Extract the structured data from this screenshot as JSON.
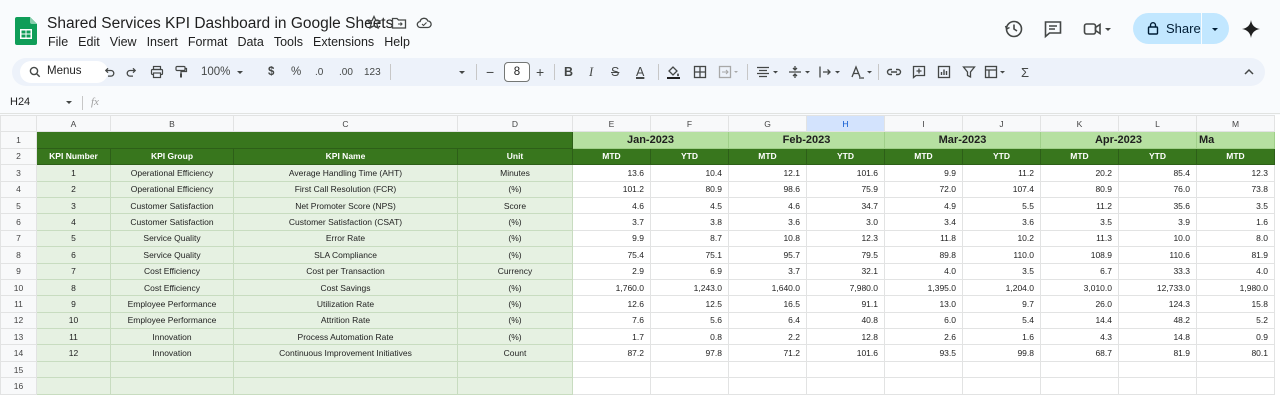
{
  "app": {
    "doc_title": "Shared Services KPI Dashboard in Google Sheets",
    "menu": [
      "File",
      "Edit",
      "View",
      "Insert",
      "Format",
      "Data",
      "Tools",
      "Extensions",
      "Help"
    ],
    "share_label": "Share",
    "brand_color": "#0f9d58"
  },
  "toolbar": {
    "search_label": "Menus",
    "zoom": "100%",
    "currency": "$",
    "percent": "%",
    "dec_less": ".0",
    "dec_more": ".00",
    "format_123": "123",
    "font_size": "8"
  },
  "formula_bar": {
    "name_box": "H24",
    "fx": "fx"
  },
  "sheet": {
    "columns": [
      "A",
      "B",
      "C",
      "D",
      "E",
      "F",
      "G",
      "H",
      "I",
      "J",
      "K",
      "L",
      "M"
    ],
    "selected_column": "H",
    "months": [
      "Jan-2023",
      "Feb-2023",
      "Mar-2023",
      "Apr-2023",
      "Ma"
    ],
    "headers": [
      "KPI Number",
      "KPI Group",
      "KPI Name",
      "Unit"
    ],
    "sub_headers": [
      "MTD",
      "YTD",
      "MTD",
      "YTD",
      "MTD",
      "YTD",
      "MTD",
      "YTD",
      "MTD"
    ],
    "row_numbers": [
      "1",
      "2",
      "3",
      "4",
      "5",
      "6",
      "7",
      "8",
      "9",
      "10",
      "11",
      "12",
      "13",
      "14",
      "15",
      "16"
    ],
    "rows": [
      [
        "1",
        "Operational Efficiency",
        "Average Handling Time (AHT)",
        "Minutes",
        "13.6",
        "10.4",
        "12.1",
        "101.6",
        "9.9",
        "11.2",
        "20.2",
        "85.4",
        "12.3"
      ],
      [
        "2",
        "Operational Efficiency",
        "First Call Resolution (FCR)",
        "(%)",
        "101.2",
        "80.9",
        "98.6",
        "75.9",
        "72.0",
        "107.4",
        "80.9",
        "76.0",
        "73.8"
      ],
      [
        "3",
        "Customer Satisfaction",
        "Net Promoter Score (NPS)",
        "Score",
        "4.6",
        "4.5",
        "4.6",
        "34.7",
        "4.9",
        "5.5",
        "11.2",
        "35.6",
        "3.5"
      ],
      [
        "4",
        "Customer Satisfaction",
        "Customer Satisfaction (CSAT)",
        "(%)",
        "3.7",
        "3.8",
        "3.6",
        "3.0",
        "3.4",
        "3.6",
        "3.5",
        "3.9",
        "1.6"
      ],
      [
        "5",
        "Service Quality",
        "Error Rate",
        "(%)",
        "9.9",
        "8.7",
        "10.8",
        "12.3",
        "11.8",
        "10.2",
        "11.3",
        "10.0",
        "8.0"
      ],
      [
        "6",
        "Service Quality",
        "SLA Compliance",
        "(%)",
        "75.4",
        "75.1",
        "95.7",
        "79.5",
        "89.8",
        "110.0",
        "108.9",
        "110.6",
        "81.9"
      ],
      [
        "7",
        "Cost Efficiency",
        "Cost per Transaction",
        "Currency",
        "2.9",
        "6.9",
        "3.7",
        "32.1",
        "4.0",
        "3.5",
        "6.7",
        "33.3",
        "4.0"
      ],
      [
        "8",
        "Cost Efficiency",
        "Cost Savings",
        "(%)",
        "1,760.0",
        "1,243.0",
        "1,640.0",
        "7,980.0",
        "1,395.0",
        "1,204.0",
        "3,010.0",
        "12,733.0",
        "1,980.0"
      ],
      [
        "9",
        "Employee Performance",
        "Utilization Rate",
        "(%)",
        "12.6",
        "12.5",
        "16.5",
        "91.1",
        "13.0",
        "9.7",
        "26.0",
        "124.3",
        "15.8"
      ],
      [
        "10",
        "Employee Performance",
        "Attrition Rate",
        "(%)",
        "7.6",
        "5.6",
        "6.4",
        "40.8",
        "6.0",
        "5.4",
        "14.4",
        "48.2",
        "5.2"
      ],
      [
        "11",
        "Innovation",
        "Process Automation Rate",
        "(%)",
        "1.7",
        "0.8",
        "2.2",
        "12.8",
        "2.6",
        "1.6",
        "4.3",
        "14.8",
        "0.9"
      ],
      [
        "12",
        "Innovation",
        "Continuous Improvement Initiatives",
        "Count",
        "87.2",
        "97.8",
        "71.2",
        "101.6",
        "93.5",
        "99.8",
        "68.7",
        "81.9",
        "80.1"
      ]
    ]
  }
}
